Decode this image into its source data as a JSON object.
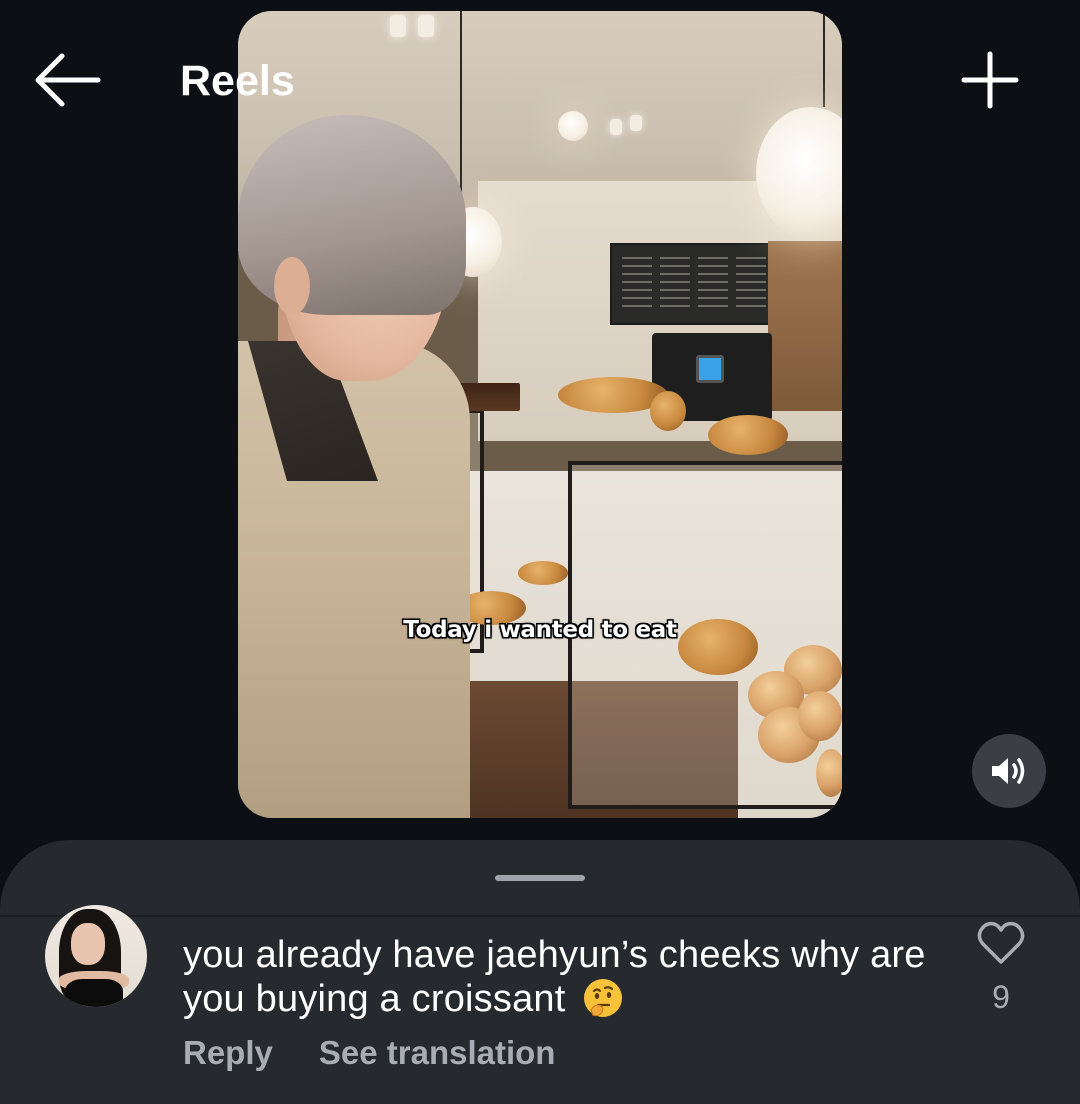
{
  "header": {
    "title": "Reels",
    "back_icon": "arrow-left-icon",
    "add_icon": "plus-icon"
  },
  "reel": {
    "caption": "Today i wanted to eat",
    "sound_icon": "speaker-on-icon"
  },
  "comment": {
    "text": "you already have jaehyun’s cheeks why are you buying a croissant",
    "emoji_icon": "thinking-face-icon",
    "reply_label": "Reply",
    "translate_label": "See translation",
    "like_count": "9",
    "like_icon": "heart-outline-icon"
  },
  "colors": {
    "background": "#0c1014",
    "sheet": "#262a2f",
    "secondary_text": "#a8adb3"
  }
}
